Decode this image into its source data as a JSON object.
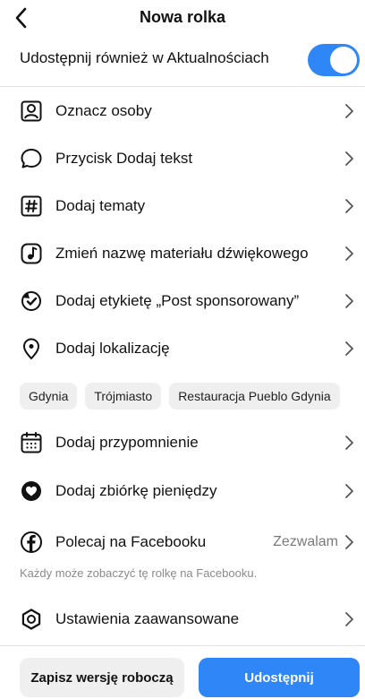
{
  "header": {
    "title": "Nowa rolka",
    "back_icon": "chevron-left-icon"
  },
  "share_feed": {
    "label": "Udostępnij również w Aktualnościach",
    "toggle_on": true,
    "toggle_color": "#2f86f6"
  },
  "menu": {
    "items": [
      {
        "label": "Oznacz osoby",
        "icon": "tag-people-icon"
      },
      {
        "label": "Przycisk Dodaj tekst",
        "icon": "speech-bubble-icon"
      },
      {
        "label": "Dodaj tematy",
        "icon": "hashtag-icon"
      },
      {
        "label": "Zmień nazwę materiału dźwiękowego",
        "icon": "audio-rename-icon"
      },
      {
        "label": "Dodaj etykietę „Post sponsorowany”",
        "icon": "paid-partnership-icon"
      },
      {
        "label": "Dodaj lokalizację",
        "icon": "location-pin-icon"
      },
      {
        "label": "Dodaj przypomnienie",
        "icon": "calendar-icon"
      },
      {
        "label": "Dodaj zbiórkę pieniędzy",
        "icon": "fundraiser-icon"
      },
      {
        "label": "Polecaj na Facebooku",
        "icon": "facebook-icon",
        "value": "Zezwalam"
      },
      {
        "label": "Ustawienia zaawansowane",
        "icon": "settings-gear-icon"
      }
    ]
  },
  "location_chips": [
    "Gdynia",
    "Trójmiasto",
    "Restauracja Pueblo Gdynia"
  ],
  "facebook_note": "Każdy może zobaczyć tę rolkę na Facebooku.",
  "bottom": {
    "draft_label": "Zapisz wersję roboczą",
    "share_label": "Udostępnij",
    "accent": "#2f86f6"
  }
}
